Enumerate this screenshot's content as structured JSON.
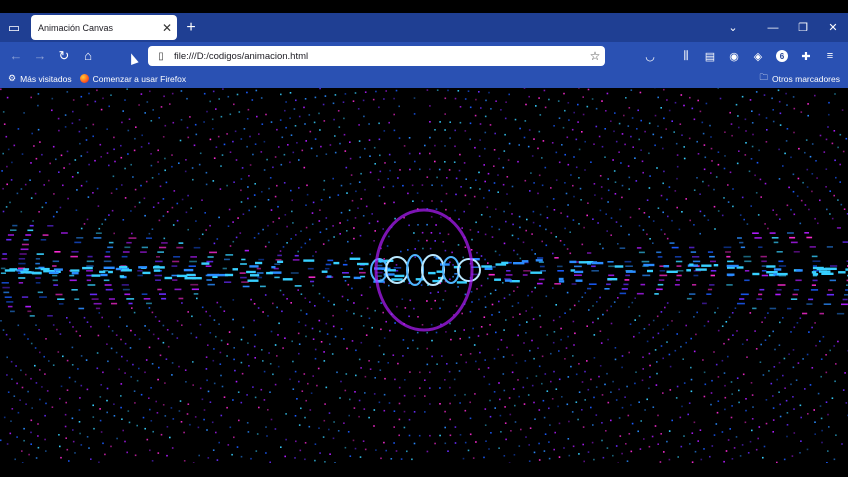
{
  "browser": {
    "tab": {
      "title": "Animación Canvas",
      "close_symbol": "✕"
    },
    "new_tab_symbol": "+",
    "window_controls": {
      "list_all_tabs": "⌄",
      "minimize": "—",
      "restore": "❐",
      "close": "✕"
    },
    "nav": {
      "back": "←",
      "forward": "→",
      "reload": "↻",
      "home": "⌂"
    },
    "url": "file:///D:/codigos/animacion.html",
    "toolbar_icons": [
      "pocket-icon",
      "library-icon",
      "sidebar-icon",
      "account-icon",
      "extension-icon",
      "profile-badge-icon",
      "puzzle-icon",
      "menu-icon"
    ],
    "profile_badge": "6",
    "bookmarks": {
      "items": [
        {
          "label": "Más visitados",
          "icon": "gear-icon"
        },
        {
          "label": "Comenzar a usar Firefox",
          "icon": "firefox-icon"
        }
      ],
      "other": "Otros marcadores"
    }
  },
  "animation": {
    "background": "#000000",
    "colors": [
      "#1a5cff",
      "#2a8cff",
      "#37d0ff",
      "#b11cff",
      "#ff2bd6",
      "#6a2bff"
    ]
  }
}
